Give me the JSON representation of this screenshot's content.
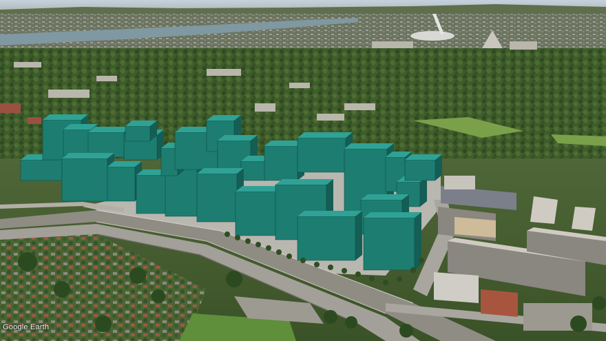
{
  "map": {
    "view": "3d-oblique-aerial",
    "attribution": "Google Earth",
    "colors": {
      "sky": "#c9d6e2",
      "horizon_haze": "#b8c2c4",
      "river": "#7f9aa6",
      "canopy": "#3d5a2a",
      "canopy_light": "#5c7a3a",
      "lawn": "#6f9a3e",
      "road": "#9a9c98",
      "rail": "#8d8a83",
      "roof_light": "#c9c6bd",
      "roof_red": "#9a5140",
      "proposed_block_front": "#1d7d71",
      "proposed_block_side": "#145e55",
      "proposed_block_top": "#2fa295"
    },
    "proposed_development": {
      "description_visible": false,
      "block_count": 26
    }
  }
}
